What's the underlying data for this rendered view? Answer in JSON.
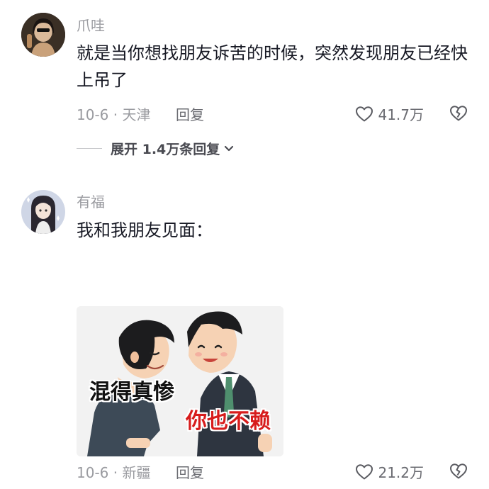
{
  "comments": [
    {
      "username": "爪哇",
      "text": "就是当你想找朋友诉苦的时候，突然发现朋友已经快上吊了",
      "date_location": "10-6 · 天津",
      "reply_label": "回复",
      "like_count": "41.7万",
      "expand_replies_label": "展开 1.4万条回复",
      "avatar_icon": "user-avatar-girl-dark"
    },
    {
      "username": "有福",
      "text": "我和我朋友见面：",
      "date_location": "10-6 · 新疆",
      "reply_label": "回复",
      "like_count": "21.2万",
      "avatar_icon": "user-avatar-anime-girl",
      "sticker": {
        "caption_left": "混得真惨",
        "caption_right": "你也不赖",
        "caption_left_color": "#111111",
        "caption_right_color": "#d71c1c"
      }
    }
  ],
  "icons": {
    "like": "heart-outline-icon",
    "dislike": "broken-heart-icon",
    "expand": "chevron-down-icon"
  },
  "colors": {
    "text_primary": "#161823",
    "text_secondary": "#9a9ba0",
    "sticker_caption_red": "#d71c1c"
  }
}
